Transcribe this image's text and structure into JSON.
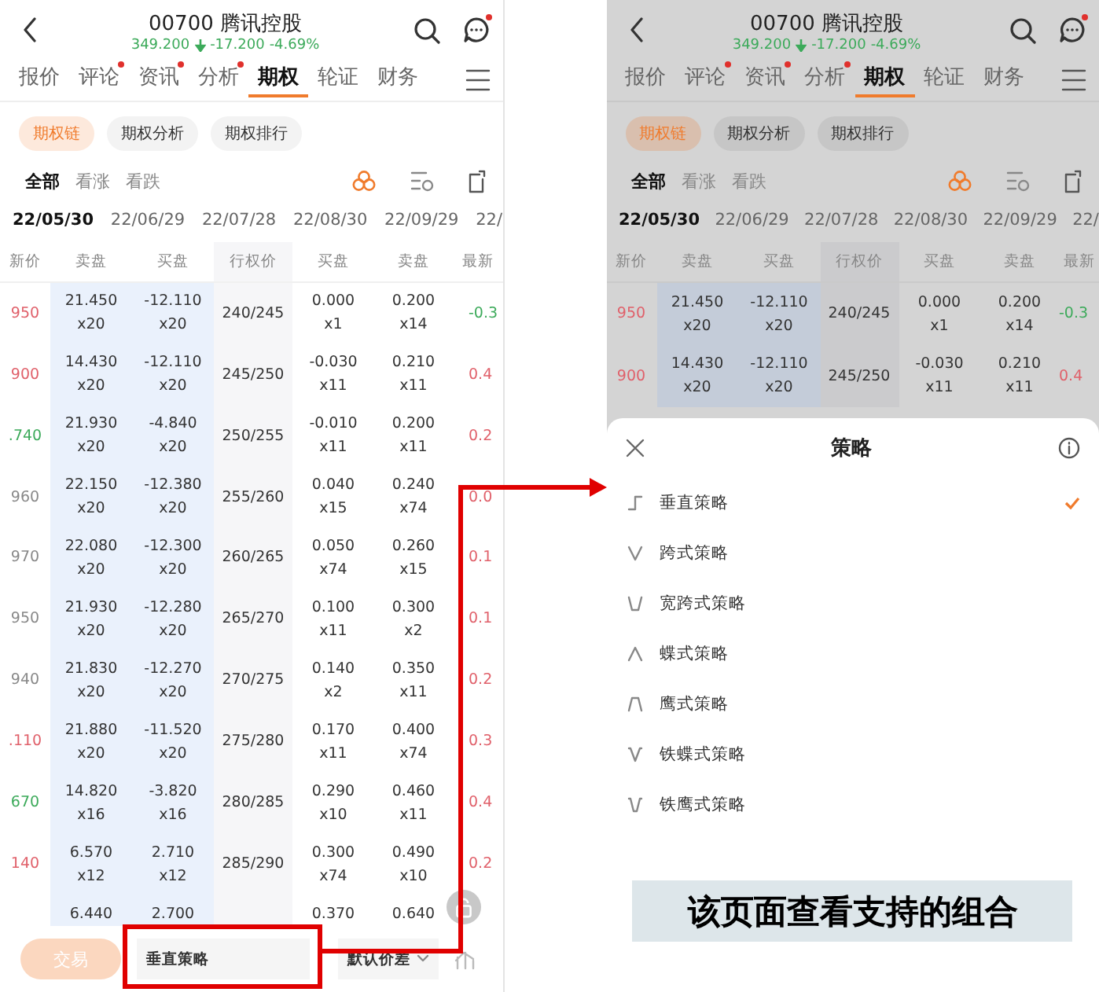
{
  "screens": [
    {
      "header": {
        "code": "00700",
        "name": "腾讯控股",
        "price": "349.200",
        "change": "-17.200",
        "percent": "-4.69%",
        "message_dot": true
      },
      "tabs": [
        {
          "label": "报价",
          "selected": false,
          "dot": false
        },
        {
          "label": "评论",
          "selected": false,
          "dot": true
        },
        {
          "label": "资讯",
          "selected": false,
          "dot": true
        },
        {
          "label": "分析",
          "selected": false,
          "dot": true
        },
        {
          "label": "期权",
          "selected": true,
          "dot": false
        },
        {
          "label": "轮证",
          "selected": false,
          "dot": false
        },
        {
          "label": "财务",
          "selected": false,
          "dot": false
        }
      ],
      "chips": [
        {
          "label": "期权链",
          "selected": true
        },
        {
          "label": "期权分析",
          "selected": false
        },
        {
          "label": "期权排行",
          "selected": false
        }
      ],
      "filters": [
        {
          "label": "全部",
          "selected": true
        },
        {
          "label": "看涨",
          "selected": false
        },
        {
          "label": "看跌",
          "selected": false
        }
      ],
      "dates": [
        {
          "label": "22/05/30",
          "selected": true
        },
        {
          "label": "22/06/29",
          "selected": false
        },
        {
          "label": "22/07/28",
          "selected": false
        },
        {
          "label": "22/08/30",
          "selected": false
        },
        {
          "label": "22/09/29",
          "selected": false
        },
        {
          "label": "22/",
          "selected": false
        }
      ],
      "columns": [
        "新价",
        "卖盘",
        "买盘",
        "行权价",
        "买盘",
        "卖盘",
        "最新"
      ],
      "rows": [
        [
          {
            "text": "950",
            "color": "#e0606a"
          },
          {
            "text": "21.450",
            "size": "x20"
          },
          {
            "text": "-12.110",
            "size": "x20"
          },
          {
            "text": "240/245"
          },
          {
            "text": "0.000",
            "size": "x1"
          },
          {
            "text": "0.200",
            "size": "x14"
          },
          {
            "text": "-0.3",
            "color": "#3caa5a"
          }
        ],
        [
          {
            "text": "900",
            "color": "#e0606a"
          },
          {
            "text": "14.430",
            "size": "x20"
          },
          {
            "text": "-12.110",
            "size": "x20"
          },
          {
            "text": "245/250"
          },
          {
            "text": "-0.030",
            "size": "x11"
          },
          {
            "text": "0.210",
            "size": "x11"
          },
          {
            "text": "0.4",
            "color": "#e0606a"
          }
        ],
        [
          {
            "text": ".740",
            "color": "#3caa5a"
          },
          {
            "text": "21.930",
            "size": "x20"
          },
          {
            "text": "-4.840",
            "size": "x20"
          },
          {
            "text": "250/255"
          },
          {
            "text": "-0.010",
            "size": "x11"
          },
          {
            "text": "0.200",
            "size": "x11"
          },
          {
            "text": "0.2",
            "color": "#e0606a"
          }
        ],
        [
          {
            "text": "960",
            "color": "#888888"
          },
          {
            "text": "22.150",
            "size": "x20"
          },
          {
            "text": "-12.380",
            "size": "x20"
          },
          {
            "text": "255/260"
          },
          {
            "text": "0.040",
            "size": "x15"
          },
          {
            "text": "0.240",
            "size": "x74"
          },
          {
            "text": "0.0",
            "color": "#e0606a"
          }
        ],
        [
          {
            "text": "970",
            "color": "#888888"
          },
          {
            "text": "22.080",
            "size": "x20"
          },
          {
            "text": "-12.300",
            "size": "x20"
          },
          {
            "text": "260/265"
          },
          {
            "text": "0.050",
            "size": "x74"
          },
          {
            "text": "0.260",
            "size": "x15"
          },
          {
            "text": "0.1",
            "color": "#e0606a"
          }
        ],
        [
          {
            "text": "950",
            "color": "#888888"
          },
          {
            "text": "21.930",
            "size": "x20"
          },
          {
            "text": "-12.280",
            "size": "x20"
          },
          {
            "text": "265/270"
          },
          {
            "text": "0.100",
            "size": "x11"
          },
          {
            "text": "0.300",
            "size": "x2"
          },
          {
            "text": "0.1",
            "color": "#e0606a"
          }
        ],
        [
          {
            "text": "940",
            "color": "#888888"
          },
          {
            "text": "21.830",
            "size": "x20"
          },
          {
            "text": "-12.270",
            "size": "x20"
          },
          {
            "text": "270/275"
          },
          {
            "text": "0.140",
            "size": "x2"
          },
          {
            "text": "0.350",
            "size": "x11"
          },
          {
            "text": "0.2",
            "color": "#e0606a"
          }
        ],
        [
          {
            "text": ".110",
            "color": "#e0606a"
          },
          {
            "text": "21.880",
            "size": "x20"
          },
          {
            "text": "-11.520",
            "size": "x20"
          },
          {
            "text": "275/280"
          },
          {
            "text": "0.170",
            "size": "x11"
          },
          {
            "text": "0.400",
            "size": "x74"
          },
          {
            "text": "0.3",
            "color": "#e0606a"
          }
        ],
        [
          {
            "text": "670",
            "color": "#3caa5a"
          },
          {
            "text": "14.820",
            "size": "x16"
          },
          {
            "text": "-3.820",
            "size": "x16"
          },
          {
            "text": "280/285"
          },
          {
            "text": "0.290",
            "size": "x10"
          },
          {
            "text": "0.460",
            "size": "x11"
          },
          {
            "text": "0.4",
            "color": "#e0606a"
          }
        ],
        [
          {
            "text": "140",
            "color": "#e0606a"
          },
          {
            "text": "6.570",
            "size": "x12"
          },
          {
            "text": "2.710",
            "size": "x12"
          },
          {
            "text": "285/290"
          },
          {
            "text": "0.300",
            "size": "x74"
          },
          {
            "text": "0.490",
            "size": "x10"
          },
          {
            "text": "0.2",
            "color": "#e0606a"
          }
        ],
        [
          "",
          {
            "text": "6.440"
          },
          {
            "text": "2.700"
          },
          "",
          {
            "text": "0.370"
          },
          {
            "text": "0.640"
          },
          ""
        ]
      ],
      "bottom_bar": {
        "trade": {
          "label": "交易",
          "disabled": true
        },
        "strategy": "垂直策略",
        "spread": "默认价差"
      }
    },
    {
      "header": {
        "code": "00700",
        "name": "腾讯控股",
        "price": "349.200",
        "change": "-17.200",
        "percent": "-4.69%",
        "message_dot": true
      },
      "tabs": [
        {
          "label": "报价",
          "selected": false,
          "dot": false
        },
        {
          "label": "评论",
          "selected": false,
          "dot": true
        },
        {
          "label": "资讯",
          "selected": false,
          "dot": true
        },
        {
          "label": "分析",
          "selected": false,
          "dot": true
        },
        {
          "label": "期权",
          "selected": true,
          "dot": false
        },
        {
          "label": "轮证",
          "selected": false,
          "dot": false
        },
        {
          "label": "财务",
          "selected": false,
          "dot": false
        }
      ],
      "chips": [
        {
          "label": "期权链",
          "selected": true
        },
        {
          "label": "期权分析",
          "selected": false
        },
        {
          "label": "期权排行",
          "selected": false
        }
      ],
      "filters": [
        {
          "label": "全部",
          "selected": true
        },
        {
          "label": "看涨",
          "selected": false
        },
        {
          "label": "看跌",
          "selected": false
        }
      ],
      "dates": [
        {
          "label": "22/05/30",
          "selected": true
        },
        {
          "label": "22/06/29",
          "selected": false
        },
        {
          "label": "22/07/28",
          "selected": false
        },
        {
          "label": "22/08/30",
          "selected": false
        },
        {
          "label": "22/09/29",
          "selected": false
        },
        {
          "label": "22/",
          "selected": false
        }
      ],
      "columns": [
        "新价",
        "卖盘",
        "买盘",
        "行权价",
        "买盘",
        "卖盘",
        "最新"
      ],
      "rows": [
        [
          {
            "text": "950",
            "color": "#e0606a"
          },
          {
            "text": "21.450",
            "size": "x20"
          },
          {
            "text": "-12.110",
            "size": "x20"
          },
          {
            "text": "240/245"
          },
          {
            "text": "0.000",
            "size": "x1"
          },
          {
            "text": "0.200",
            "size": "x14"
          },
          {
            "text": "-0.3",
            "color": "#3caa5a"
          }
        ],
        [
          {
            "text": "900",
            "color": "#e0606a"
          },
          {
            "text": "14.430",
            "size": "x20"
          },
          {
            "text": "-12.110",
            "size": "x20"
          },
          {
            "text": "245/250"
          },
          {
            "text": "-0.030",
            "size": "x11"
          },
          {
            "text": "0.210",
            "size": "x11"
          },
          {
            "text": "0.4",
            "color": "#e0606a"
          }
        ]
      ],
      "sheet": {
        "title": "策略",
        "items": [
          {
            "label": "垂直策略",
            "kind": "vertical",
            "selected": true
          },
          {
            "label": "跨式策略",
            "kind": "straddle",
            "selected": false
          },
          {
            "label": "宽跨式策略",
            "kind": "strangle",
            "selected": false
          },
          {
            "label": "蝶式策略",
            "kind": "butterfly",
            "selected": false
          },
          {
            "label": "鹰式策略",
            "kind": "condor",
            "selected": false
          },
          {
            "label": "铁蝶式策略",
            "kind": "iron_butterfly",
            "selected": false
          },
          {
            "label": "铁鹰式策略",
            "kind": "iron_condor",
            "selected": false
          }
        ],
        "caption": "该页面查看支持的组合"
      }
    }
  ]
}
